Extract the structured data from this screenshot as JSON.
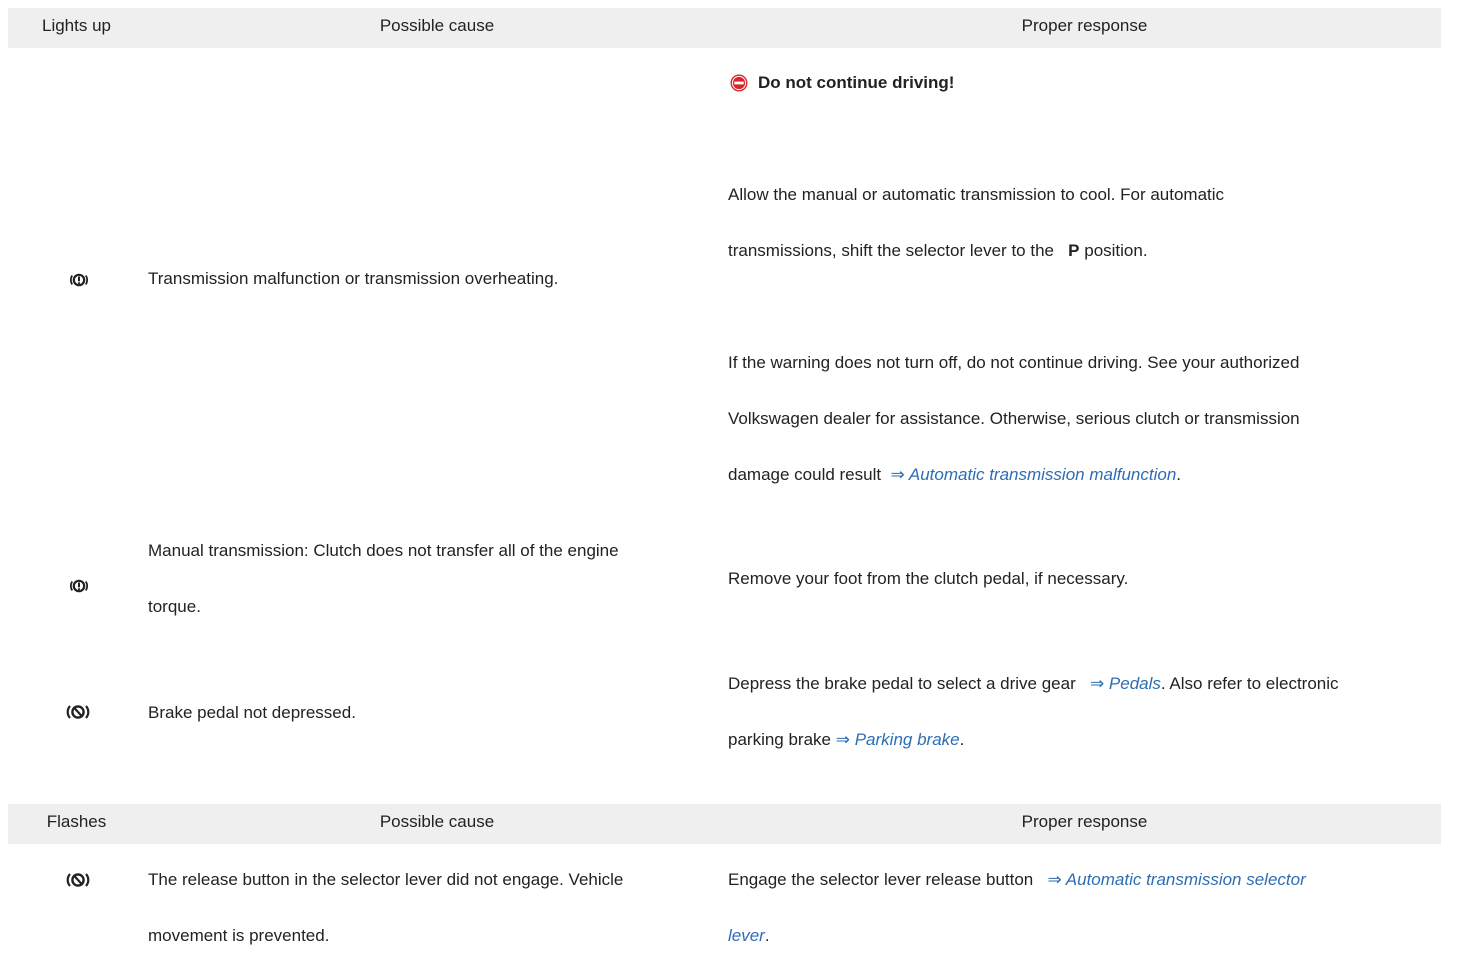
{
  "table1": {
    "headers": [
      "Lights up",
      "Possible cause",
      "Proper response"
    ],
    "row1": {
      "icon": "transmission-warning-icon",
      "cause": "Transmission malfunction or transmission overheating.",
      "warning": "Do not continue driving!",
      "response_a_line1": "Allow the manual or automatic transmission to cool. For automatic",
      "response_a_line2_pre": "transmissions, shift the selector lever to the",
      "response_a_bold": "P",
      "response_a_line2_post": "position.",
      "response_b_line1": "If the warning does not turn off, do not continue driving. See your authorized",
      "response_b_line2": "Volkswagen dealer for assistance. Otherwise, serious clutch or transmission",
      "response_b_line3_pre": "damage could result",
      "response_b_link": "⇒ Automatic transmission malfunction",
      "response_b_line3_post": "."
    },
    "row2": {
      "icon": "transmission-warning-icon",
      "cause_line1": "Manual transmission: Clutch does not transfer all of the engine",
      "cause_line2": "torque.",
      "response": "Remove your foot from the clutch pedal, if necessary."
    },
    "row3": {
      "icon": "foot-brake-icon",
      "cause": "Brake pedal not depressed.",
      "response_line1_pre": "Depress the brake pedal to select a drive gear",
      "response_link1": "⇒ Pedals",
      "response_line1_post": ". Also refer to electronic",
      "response_line2_pre": "parking brake",
      "response_link2": "⇒ Parking brake",
      "response_line2_post": "."
    }
  },
  "table2": {
    "headers": [
      "Flashes",
      "Possible cause",
      "Proper response"
    ],
    "row1": {
      "icon": "foot-brake-icon",
      "cause_line1": "The release button in the selector lever did not engage. Vehicle",
      "cause_line2": "movement is prevented.",
      "response_line1_pre": "Engage the selector lever release button",
      "response_link": "⇒ Automatic transmission selector",
      "response_link_line2": "lever",
      "response_line2_post": "."
    }
  },
  "colors": {
    "header_bg": "#efefef",
    "link": "#2e6db4",
    "stop_red": "#d9262b"
  }
}
